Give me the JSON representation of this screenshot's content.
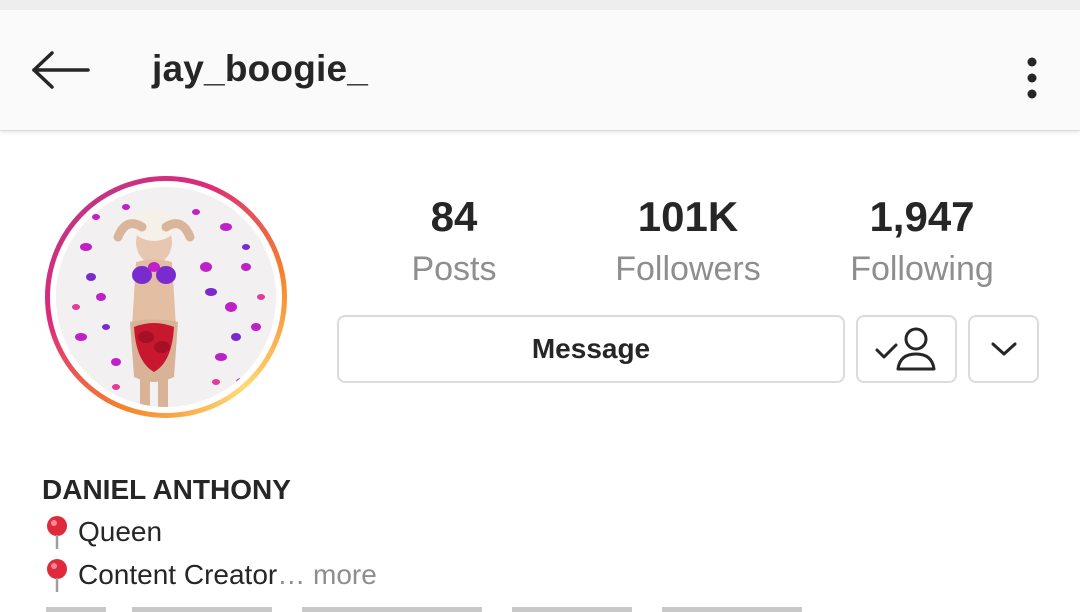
{
  "header": {
    "username": "jay_boogie_",
    "back_icon": "arrow-left-icon",
    "menu_icon": "more-vertical-icon"
  },
  "profile": {
    "stats": [
      {
        "value": "84",
        "label": "Posts"
      },
      {
        "value": "101K",
        "label": "Followers"
      },
      {
        "value": "1,947",
        "label": "Following"
      }
    ],
    "buttons": {
      "message_label": "Message",
      "following_icon": "user-check-icon",
      "dropdown_icon": "chevron-down-icon"
    }
  },
  "bio": {
    "name": "DANIEL ANTHONY",
    "lines": [
      {
        "icon": "pin-icon",
        "text": "Queen"
      },
      {
        "icon": "pin-icon",
        "text": "Content Creator",
        "ellipsis": "…",
        "more": " more"
      }
    ]
  },
  "colors": {
    "text": "#262626",
    "secondary_text": "#8e8e8e",
    "border": "#dbdbdb",
    "ring_start": "#f58529",
    "ring_end": "#dd2a7b",
    "pin": "#e0293b"
  }
}
